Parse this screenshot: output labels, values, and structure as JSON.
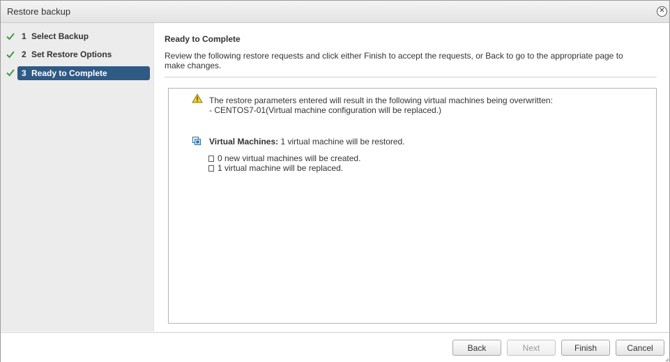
{
  "window": {
    "title": "Restore backup",
    "close_glyph": "✕"
  },
  "steps": [
    {
      "number": "1",
      "label": "Select Backup",
      "completed": true,
      "active": false,
      "icon": "checkmark-icon"
    },
    {
      "number": "2",
      "label": "Set Restore Options",
      "completed": true,
      "active": false,
      "icon": "checkmark-icon"
    },
    {
      "number": "3",
      "label": "Ready to Complete",
      "completed": true,
      "active": true,
      "icon": "checkmark-icon"
    }
  ],
  "page": {
    "title": "Ready to Complete",
    "description": "Review the following restore requests and click either Finish to accept the requests, or Back to go to the appropriate page to make changes."
  },
  "summary": {
    "warning_icon": "warning-icon",
    "warning_line1": "The restore parameters entered will result in the following virtual machines being overwritten:",
    "warning_line2": "- CENTOS7-01(Virtual machine configuration will be replaced.)",
    "vm_icon": "virtual-machines-icon",
    "vm_label": "Virtual Machines:",
    "vm_value": "1 virtual machine will be restored.",
    "items": [
      "0 new virtual machines will be created.",
      "1 virtual machine will be replaced."
    ]
  },
  "buttons": {
    "back": "Back",
    "next": "Next",
    "finish": "Finish",
    "cancel": "Cancel",
    "next_disabled": true
  },
  "colors": {
    "active_step_bg": "#2f5a86",
    "check_green": "#3f9b3f",
    "warning_yellow": "#f2d22e"
  }
}
